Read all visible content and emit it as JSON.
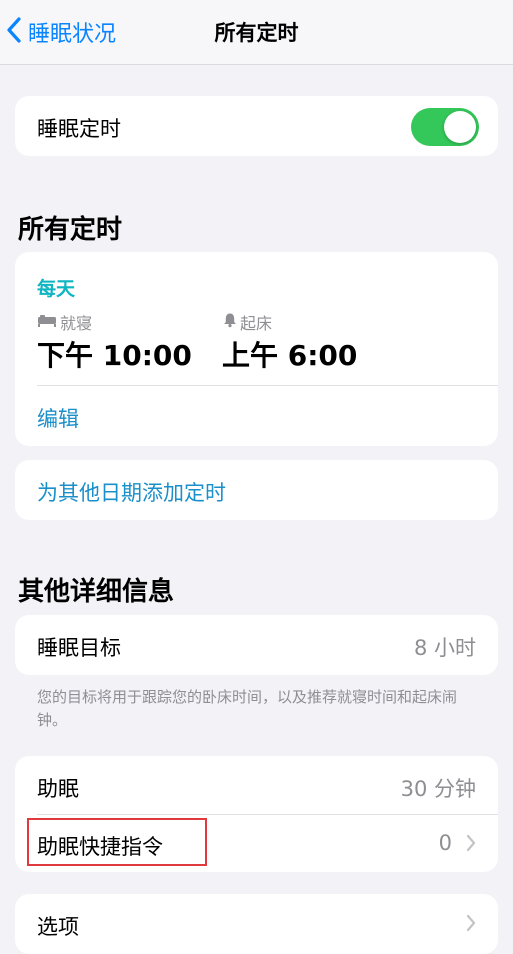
{
  "nav": {
    "back_label": "睡眠状况",
    "title": "所有定时"
  },
  "sleep_schedule": {
    "label": "睡眠定时",
    "enabled": true
  },
  "all_schedules": {
    "section_title": "所有定时",
    "frequency": "每天",
    "bedtime_label": "就寝",
    "bedtime_value": "下午 10:00",
    "wake_label": "起床",
    "wake_value": "上午 6:00",
    "edit_label": "编辑",
    "add_label": "为其他日期添加定时"
  },
  "details": {
    "section_title": "其他详细信息",
    "sleep_goal_label": "睡眠目标",
    "sleep_goal_value": "8 小时",
    "footnote": "您的目标将用于跟踪您的卧床时间，以及推荐就寝时间和起床闹钟。",
    "wind_down_label": "助眠",
    "wind_down_value": "30 分钟",
    "shortcuts_label": "助眠快捷指令",
    "shortcuts_value": "0",
    "options_label": "选项"
  },
  "colors": {
    "accent_blue": "#0a84ff",
    "toggle_green": "#34c759",
    "teal": "#0fb5c0",
    "highlight_red": "#e0393e"
  },
  "icons": {
    "back": "chevron-left-icon",
    "bed": "bed-icon",
    "bell": "bell-icon",
    "disclosure": "chevron-right-icon"
  }
}
